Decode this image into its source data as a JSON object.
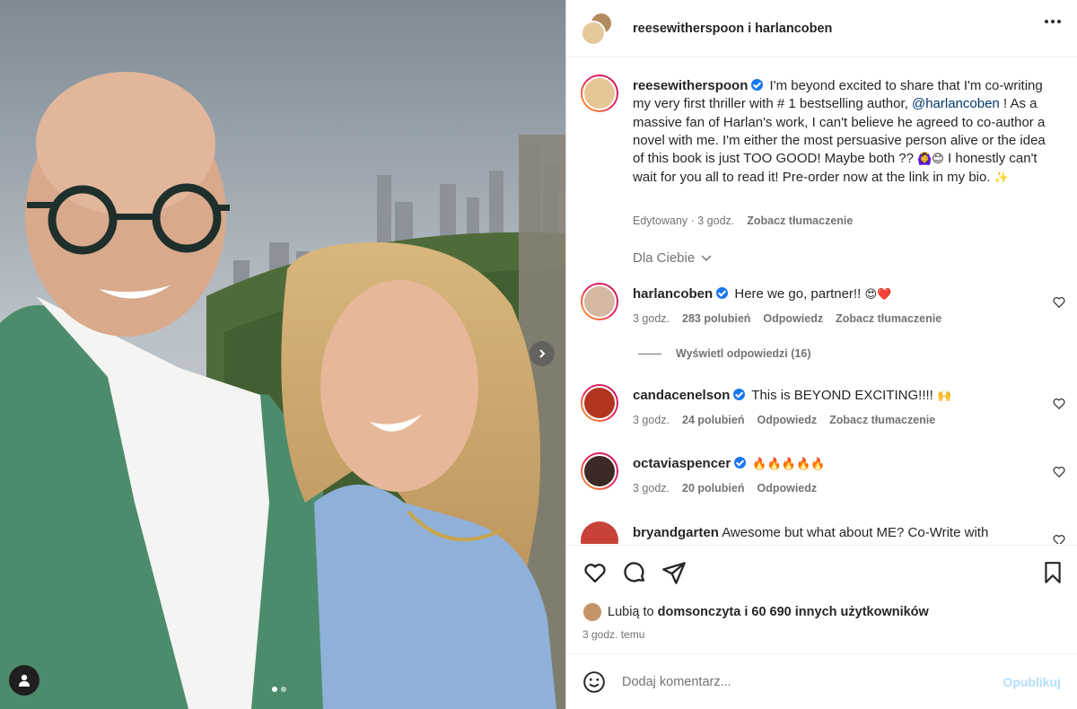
{
  "header": {
    "names": "reesewitherspoon i harlancoben",
    "more_icon": "more-horizontal-icon"
  },
  "caption": {
    "username": "reesewitherspoon",
    "text_1": "I'm beyond excited to share that I'm co-writing my very first thriller with # 1 bestselling author,",
    "mention": "@harlancoben",
    "text_2": "! As a massive fan of Harlan's work, I can't believe he agreed to co-author a novel with me. I'm either the most persuasive person alive or the idea of this book is just TOO GOOD! Maybe both ??",
    "text_3": "I honestly can't wait for you all to read it! Pre-order now at the link in my bio.",
    "emoji_1": "🙆‍♀️😊",
    "emoji_2": "✨",
    "edited": "Edytowany · 3 godz.",
    "translate": "Zobacz tłumaczenie"
  },
  "for_you": "Dla Ciebie",
  "comments": [
    {
      "username": "harlancoben",
      "text": "Here we go, partner!!",
      "emoji": "😍❤️",
      "time": "3 godz.",
      "likes": "283 polubień",
      "reply": "Odpowiedz",
      "translate": "Zobacz tłumaczenie"
    },
    {
      "username": "candacenelson",
      "text": "This is BEYOND EXCITING!!!!",
      "emoji": "🙌",
      "time": "3 godz.",
      "likes": "24 polubień",
      "reply": "Odpowiedz",
      "translate": "Zobacz tłumaczenie"
    },
    {
      "username": "octaviaspencer",
      "text": "",
      "emoji": "🔥🔥🔥🔥🔥",
      "time": "3 godz.",
      "likes": "20 polubień",
      "reply": "Odpowiedz"
    },
    {
      "username": "bryandgarten",
      "text": "Awesome but what about ME? Co-Write with"
    }
  ],
  "view_replies": "Wyświetl odpowiedzi (16)",
  "likes_line": {
    "prefix": "Lubią to",
    "user": "domsonczyta",
    "suffix": "i 60 690 innych użytkowników"
  },
  "time_ago": "3 godz. temu",
  "composer": {
    "placeholder": "Dodaj komentarz...",
    "publish": "Opublikuj"
  },
  "colors": {
    "verified": "#1877f2",
    "mention": "#00376b",
    "publish_disabled": "#b2dffc"
  }
}
